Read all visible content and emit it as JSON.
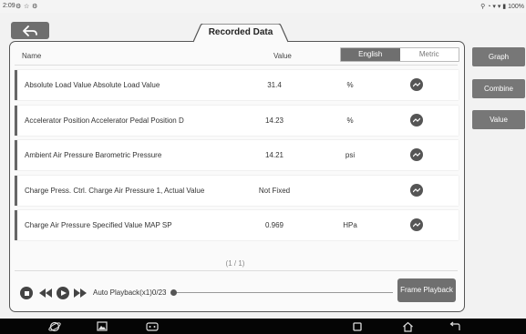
{
  "status_bar": {
    "time": "2:09",
    "right_text": "⚲ ◔ ▾ ▾ ▮ 100%"
  },
  "page": {
    "title": "Recorded Data"
  },
  "table": {
    "headers": {
      "name": "Name",
      "value": "Value"
    },
    "unit_toggle": {
      "options": [
        "English",
        "Metric"
      ],
      "selected": "English"
    },
    "rows": [
      {
        "name": "Absolute Load Value Absolute Load Value",
        "value": "31.4",
        "unit": "%"
      },
      {
        "name": "Accelerator Position Accelerator Pedal Position D",
        "value": "14.23",
        "unit": "%"
      },
      {
        "name": "Ambient Air Pressure Barometric Pressure",
        "value": "14.21",
        "unit": "psi"
      },
      {
        "name": "Charge Press. Ctrl. Charge Air Pressure 1, Actual Value",
        "value": "Not Fixed",
        "unit": ""
      },
      {
        "name": "Charge Air Pressure Specified Value MAP SP",
        "value": "0.969",
        "unit": "HPa"
      }
    ],
    "pagination": "(1 / 1)"
  },
  "playback": {
    "label": "Auto Playback(x1)0/23",
    "progress": 0,
    "frame_button": "Frame Playback"
  },
  "side_buttons": [
    "Graph",
    "Combine",
    "Value"
  ],
  "icons": {
    "back": "back-arrow-icon",
    "row_action": "line-graph-icon",
    "nav": [
      "browser-icon",
      "gallery-icon",
      "vci-icon",
      "recents-icon",
      "home-icon",
      "return-icon"
    ]
  },
  "colors": {
    "accent": "#6f6f6f",
    "button": "#777777",
    "navbar": "#050505"
  }
}
